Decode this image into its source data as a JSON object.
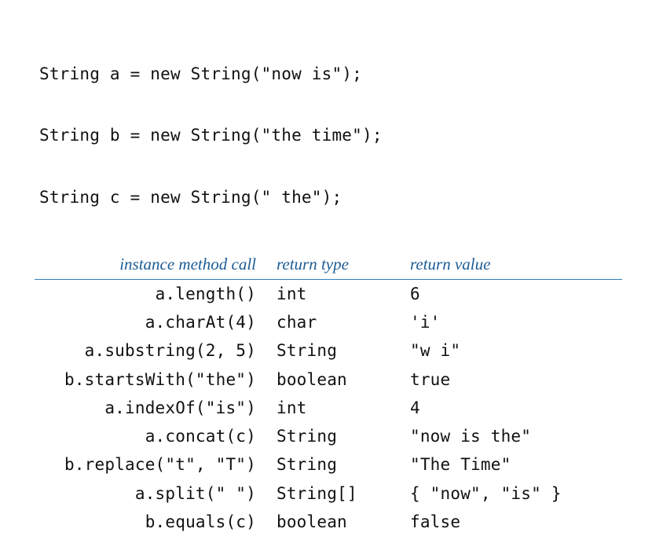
{
  "code": {
    "line1": "String a = new String(\"now is\");",
    "line2": "String b = new String(\"the time\");",
    "line3": "String c = new String(\" the\");"
  },
  "table": {
    "headers": {
      "col1": "instance method call",
      "col2": "return type",
      "col3": "return value"
    },
    "rows": [
      {
        "call": "a.length()",
        "type": "int",
        "value": "6"
      },
      {
        "call": "a.charAt(4)",
        "type": "char",
        "value": "'i'"
      },
      {
        "call": "a.substring(2, 5)",
        "type": "String",
        "value": "\"w i\""
      },
      {
        "call": "b.startsWith(\"the\")",
        "type": "boolean",
        "value": "true"
      },
      {
        "call": "a.indexOf(\"is\")",
        "type": "int",
        "value": "4"
      },
      {
        "call": "a.concat(c)",
        "type": "String",
        "value": "\"now is the\""
      },
      {
        "call": "b.replace(\"t\", \"T\")",
        "type": "String",
        "value": "\"The Time\""
      },
      {
        "call": "a.split(\" \")",
        "type": "String[]",
        "value": "{ \"now\", \"is\" }"
      },
      {
        "call": "b.equals(c)",
        "type": "boolean",
        "value": "false"
      }
    ]
  }
}
